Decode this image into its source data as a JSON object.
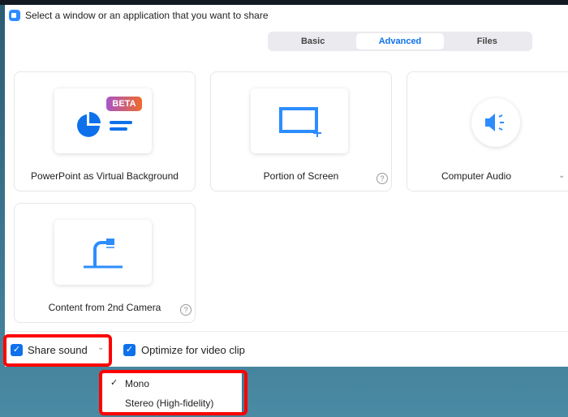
{
  "window": {
    "title": "Select a window or an application that you want to share"
  },
  "tabs": [
    {
      "label": "Basic"
    },
    {
      "label": "Advanced",
      "active": true
    },
    {
      "label": "Files"
    }
  ],
  "cards": [
    {
      "label": "PowerPoint as Virtual Background",
      "badge": "BETA",
      "icon": "pie-chart-icon"
    },
    {
      "label": "Portion of Screen",
      "icon": "screen-portion-icon",
      "help": "?"
    },
    {
      "label": "Computer Audio",
      "icon": "speaker-icon"
    },
    {
      "label": "Content from 2nd Camera",
      "icon": "document-camera-icon",
      "help": "?"
    }
  ],
  "bottom": {
    "share_sound": "Share sound",
    "share_sound_checked": true,
    "optimize": "Optimize for video clip",
    "optimize_checked": true
  },
  "sound_menu": {
    "items": [
      {
        "label": "Mono",
        "selected": true
      },
      {
        "label": "Stereo (High-fidelity)",
        "selected": false
      }
    ],
    "check": "✓"
  },
  "colors": {
    "accent": "#0e71eb",
    "highlight": "#ff0000"
  }
}
